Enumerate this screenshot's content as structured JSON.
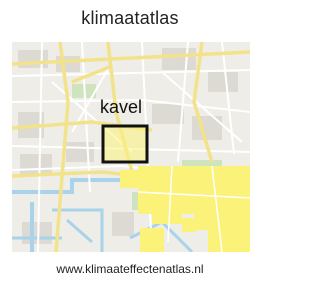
{
  "header": {
    "title": "klimaatatlas"
  },
  "map": {
    "marker_label": "kavel",
    "colors": {
      "background": "#eeede8",
      "road": "#ffffff",
      "main_road": "#f2e38a",
      "water": "#a9d3ea",
      "park": "#c9dfb9",
      "highlight": "#fbf27a",
      "marker": "#111111"
    }
  },
  "footer": {
    "url": "www.klimaateffectenatlas.nl"
  }
}
